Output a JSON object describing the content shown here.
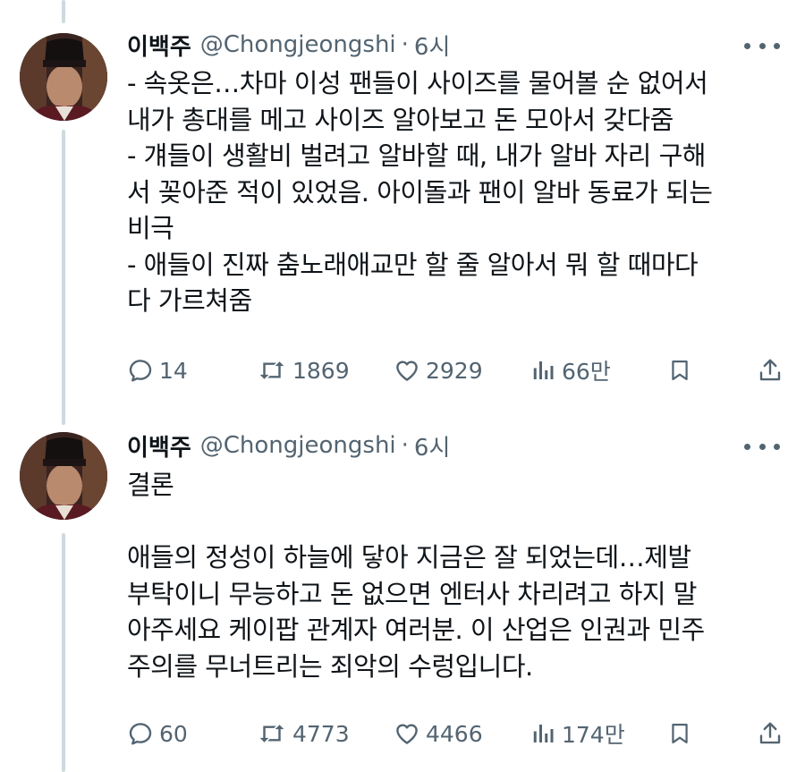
{
  "tweets": [
    {
      "name": "이백주",
      "handle": "@Chongjeongshi",
      "separator": "·",
      "time": "6시",
      "text": "- 속옷은…차마 이성 팬들이 사이즈를 물어볼 순 없어서\n내가 총대를 메고 사이즈 알아보고 돈 모아서 갖다줌\n- 걔들이 생활비 벌려고 알바할 때, 내가 알바 자리 구해\n서 꽂아준 적이 있었음. 아이돌과 팬이 알바 동료가 되는\n비극\n- 애들이 진짜 춤노래애교만 할 줄 알아서 뭐 할 때마다\n다 가르쳐줌",
      "replies": "14",
      "retweets": "1869",
      "likes": "2929",
      "views": "66만"
    },
    {
      "name": "이백주",
      "handle": "@Chongjeongshi",
      "separator": "·",
      "time": "6시",
      "text": "결론\n\n애들의 정성이 하늘에 닿아 지금은 잘 되었는데…제발\n부탁이니 무능하고 돈 없으면 엔터사 차리려고 하지 말\n아주세요 케이팝 관계자 여러분. 이 산업은 인권과 민주\n주의를 무너트리는 죄악의 수렁입니다.",
      "replies": "60",
      "retweets": "4773",
      "likes": "4466",
      "views": "174만"
    }
  ],
  "icons": {
    "reply": "reply-icon",
    "retweet": "retweet-icon",
    "like": "heart-icon",
    "views": "views-icon",
    "bookmark": "bookmark-icon",
    "share": "share-icon",
    "more": "more-icon"
  },
  "colors": {
    "text": "#0f1419",
    "secondary": "#536471",
    "thread_line": "#cfd9de",
    "background": "#ffffff"
  }
}
